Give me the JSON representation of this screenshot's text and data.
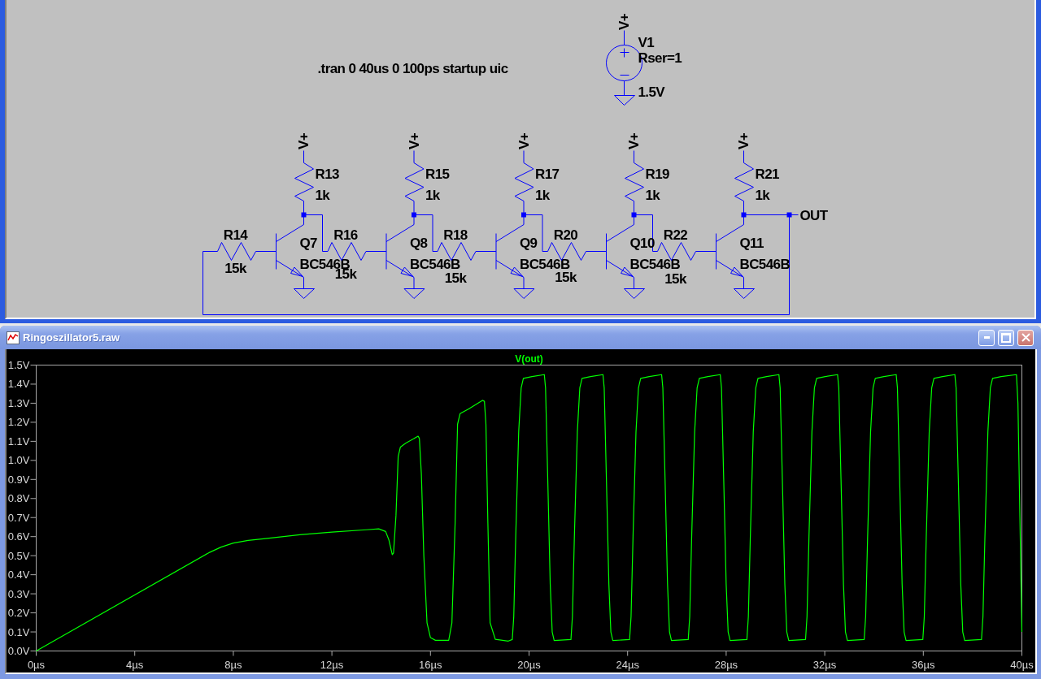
{
  "schematic": {
    "source": {
      "net": "V+",
      "name": "V1",
      "parameter": "Rser=1",
      "value": "1.5V"
    },
    "directive": ".tran 0 40us 0 100ps startup uic",
    "stages": [
      {
        "supply": "V+",
        "load_resistor": {
          "name": "R13",
          "value": "1k"
        },
        "input_resistor": {
          "name": "R14",
          "value": "15k"
        },
        "transistor": {
          "name": "Q7",
          "model": "BC546B"
        }
      },
      {
        "supply": "V+",
        "load_resistor": {
          "name": "R15",
          "value": "1k"
        },
        "input_resistor": {
          "name": "R16",
          "value": "15k"
        },
        "transistor": {
          "name": "Q8",
          "model": "BC546B"
        }
      },
      {
        "supply": "V+",
        "load_resistor": {
          "name": "R17",
          "value": "1k"
        },
        "input_resistor": {
          "name": "R18",
          "value": "15k"
        },
        "transistor": {
          "name": "Q9",
          "model": "BC546B"
        }
      },
      {
        "supply": "V+",
        "load_resistor": {
          "name": "R19",
          "value": "1k"
        },
        "input_resistor": {
          "name": "R20",
          "value": "15k"
        },
        "transistor": {
          "name": "Q10",
          "model": "BC546B"
        }
      },
      {
        "supply": "V+",
        "load_resistor": {
          "name": "R21",
          "value": "1k"
        },
        "input_resistor": {
          "name": "R22",
          "value": "15k"
        },
        "transistor": {
          "name": "Q11",
          "model": "BC546B"
        }
      }
    ],
    "output_label": "OUT"
  },
  "plot_window": {
    "title": "Ringoszillator5.raw",
    "chart_data": {
      "type": "line",
      "xlim": [
        0,
        40
      ],
      "ylim": [
        0,
        1.5
      ],
      "xticks": [
        {
          "value": 0,
          "label": "0µs"
        },
        {
          "value": 4,
          "label": "4µs"
        },
        {
          "value": 8,
          "label": "8µs"
        },
        {
          "value": 12,
          "label": "12µs"
        },
        {
          "value": 16,
          "label": "16µs"
        },
        {
          "value": 20,
          "label": "20µs"
        },
        {
          "value": 24,
          "label": "24µs"
        },
        {
          "value": 28,
          "label": "28µs"
        },
        {
          "value": 32,
          "label": "32µs"
        },
        {
          "value": 36,
          "label": "36µs"
        },
        {
          "value": 40,
          "label": "40µs"
        }
      ],
      "yticks": [
        {
          "value": 0,
          "label": "0.0V"
        },
        {
          "value": 0.1,
          "label": "0.1V"
        },
        {
          "value": 0.2,
          "label": "0.2V"
        },
        {
          "value": 0.3,
          "label": "0.3V"
        },
        {
          "value": 0.4,
          "label": "0.4V"
        },
        {
          "value": 0.5,
          "label": "0.5V"
        },
        {
          "value": 0.6,
          "label": "0.6V"
        },
        {
          "value": 0.7,
          "label": "0.7V"
        },
        {
          "value": 0.8,
          "label": "0.8V"
        },
        {
          "value": 0.9,
          "label": "0.9V"
        },
        {
          "value": 1.0,
          "label": "1.0V"
        },
        {
          "value": 1.1,
          "label": "1.1V"
        },
        {
          "value": 1.2,
          "label": "1.2V"
        },
        {
          "value": 1.3,
          "label": "1.3V"
        },
        {
          "value": 1.4,
          "label": "1.4V"
        },
        {
          "value": 1.5,
          "label": "1.5V"
        }
      ],
      "x": [
        0,
        7.0,
        7.5,
        8.0,
        8.6,
        9.3,
        10.7,
        12.0,
        13.4,
        13.9,
        14.18,
        14.31,
        14.45,
        14.5,
        14.6,
        14.69,
        14.78,
        14.99,
        15.5,
        15.55,
        15.63,
        15.73,
        15.86,
        16.0,
        16.2,
        16.74,
        16.87,
        17.0,
        17.1,
        17.2,
        17.55,
        18.11,
        18.19,
        18.25,
        18.33,
        18.42,
        18.63,
        19.16,
        19.32,
        19.38,
        19.46,
        19.58,
        19.68,
        19.77,
        20.12,
        20.62,
        20.67,
        20.76,
        20.86,
        20.94,
        21.02,
        21.7,
        21.76,
        21.84,
        21.96,
        22.06,
        22.15,
        22.5,
        23.0,
        23.05,
        23.14,
        23.24,
        23.32,
        23.4,
        24.08,
        24.14,
        24.22,
        24.34,
        24.44,
        24.53,
        24.88,
        25.38,
        25.43,
        25.52,
        25.62,
        25.7,
        25.78,
        26.46,
        26.52,
        26.6,
        26.72,
        26.82,
        26.91,
        27.26,
        27.76,
        27.81,
        27.9,
        28.0,
        28.08,
        28.16,
        28.84,
        28.9,
        28.98,
        29.1,
        29.2,
        29.29,
        29.64,
        30.14,
        30.19,
        30.28,
        30.38,
        30.46,
        30.54,
        31.22,
        31.28,
        31.36,
        31.48,
        31.58,
        31.67,
        32.02,
        32.52,
        32.57,
        32.66,
        32.76,
        32.84,
        32.92,
        33.6,
        33.66,
        33.74,
        33.86,
        33.96,
        34.05,
        34.4,
        34.9,
        34.95,
        35.04,
        35.14,
        35.22,
        35.3,
        35.98,
        36.04,
        36.12,
        36.24,
        36.34,
        36.43,
        36.78,
        37.28,
        37.33,
        37.42,
        37.52,
        37.6,
        37.68,
        38.36,
        38.42,
        38.5,
        38.62,
        38.72,
        38.81,
        39.16,
        39.78,
        39.84,
        39.92,
        40
      ],
      "series": [
        {
          "name": "V(out)",
          "color": "#00ff00",
          "values": [
            0,
            0.515,
            0.545,
            0.566,
            0.58,
            0.59,
            0.61,
            0.624,
            0.636,
            0.641,
            0.627,
            0.584,
            0.505,
            0.514,
            0.71,
            1.02,
            1.07,
            1.09,
            1.127,
            1.115,
            0.93,
            0.5,
            0.148,
            0.07,
            0.056,
            0.056,
            0.148,
            0.67,
            1.19,
            1.245,
            1.27,
            1.315,
            1.31,
            1.19,
            0.67,
            0.148,
            0.061,
            0.052,
            0.06,
            0.18,
            0.6,
            1.15,
            1.38,
            1.43,
            1.44,
            1.45,
            1.38,
            0.9,
            0.35,
            0.1,
            0.055,
            0.06,
            0.18,
            0.6,
            1.15,
            1.38,
            1.43,
            1.44,
            1.45,
            1.38,
            0.9,
            0.35,
            0.1,
            0.055,
            0.06,
            0.18,
            0.6,
            1.15,
            1.38,
            1.43,
            1.44,
            1.45,
            1.38,
            0.9,
            0.35,
            0.1,
            0.055,
            0.06,
            0.18,
            0.6,
            1.15,
            1.38,
            1.43,
            1.44,
            1.45,
            1.38,
            0.9,
            0.35,
            0.1,
            0.055,
            0.06,
            0.18,
            0.6,
            1.15,
            1.38,
            1.43,
            1.44,
            1.45,
            1.38,
            0.9,
            0.35,
            0.1,
            0.055,
            0.06,
            0.18,
            0.6,
            1.15,
            1.38,
            1.43,
            1.44,
            1.45,
            1.38,
            0.9,
            0.35,
            0.1,
            0.055,
            0.06,
            0.18,
            0.6,
            1.15,
            1.38,
            1.43,
            1.44,
            1.45,
            1.38,
            0.9,
            0.35,
            0.1,
            0.055,
            0.06,
            0.18,
            0.6,
            1.15,
            1.38,
            1.43,
            1.44,
            1.45,
            1.38,
            0.9,
            0.35,
            0.1,
            0.055,
            0.06,
            0.18,
            0.6,
            1.15,
            1.38,
            1.43,
            1.44,
            1.45,
            1.3,
            0.7,
            0.1
          ]
        }
      ]
    }
  }
}
